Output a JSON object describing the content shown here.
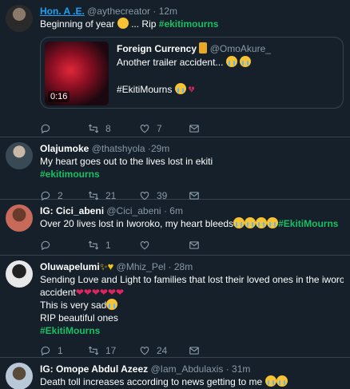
{
  "tweets": [
    {
      "name": "Hon. A .E.",
      "handle": "@aythecreator",
      "time": "12m",
      "body_pre": "Beginning of year",
      "body_mid": " ... Rip ",
      "hashtag": "#ekitimourns",
      "quote": {
        "name": "Foreign Currency",
        "handle": "@OmoAkure_",
        "text": "Another trailer accident...",
        "hashtag": "#EkitiMourns",
        "duration": "0:16"
      },
      "reply_count": "",
      "retweet_count": "8",
      "like_count": "7"
    },
    {
      "name": "Olajumoke",
      "handle": "@thatshyola",
      "time": "29m",
      "body": "My heart goes out to the lives lost in ekiti",
      "hashtag": "#ekitimourns",
      "reply_count": "2",
      "retweet_count": "21",
      "like_count": "39"
    },
    {
      "name": "IG: Cici_abeni",
      "handle": "@Cici_abeni",
      "time": "6m",
      "body": "Over 20 lives lost in Iworoko, my heart bleeds",
      "hashtag": "#EkitiMourns",
      "reply_count": "",
      "retweet_count": "1",
      "like_count": ""
    },
    {
      "name": "Oluwapelumi",
      "handle": "@Mhiz_Pel",
      "time": "28m",
      "line1": "Sending Love and Light to families that lost their loved ones in the iworoko",
      "line2": "accident",
      "line3": "This is very sad",
      "line4": "RIP beautiful ones",
      "hashtag": "#EkitiMourns",
      "reply_count": "1",
      "retweet_count": "17",
      "like_count": "24"
    },
    {
      "name": "IG: Omope Abdul Azeez",
      "handle": "@Iam_Abdulaxis",
      "time": "31m",
      "body": "Death toll increases according to news getting to me"
    }
  ],
  "icons": {
    "reply": "reply-icon",
    "retweet": "retweet-icon",
    "like": "heart-icon",
    "share": "mail-icon"
  },
  "colors": {
    "background": "#15202b",
    "hashtag": "#17bf63",
    "link": "#1da1f2",
    "muted": "#8899a6",
    "border": "#38444d"
  }
}
